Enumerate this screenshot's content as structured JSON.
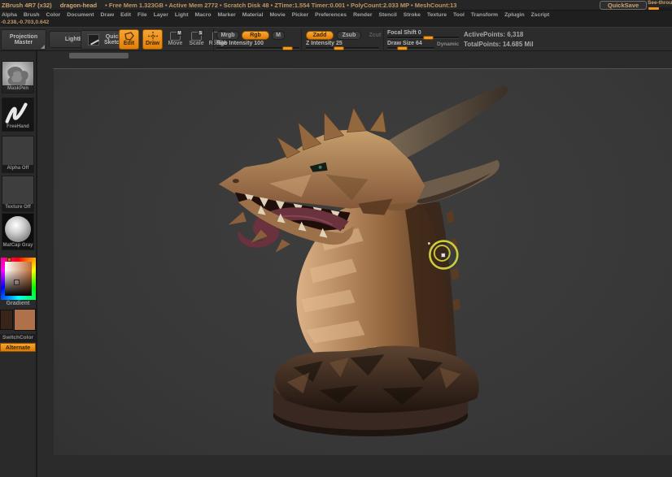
{
  "titlebar": {
    "app": "ZBrush 4R7 (x32)",
    "document_name": "dragon-head",
    "stats": "• Free Mem 1.323GB • Active Mem 2772 • Scratch Disk 48 • ZTime:1.554 Timer:0.001 • PolyCount:2.033 MP • MeshCount:13",
    "quicksave": "QuickSave",
    "seethrough": "See-through"
  },
  "menubar": {
    "items": [
      "Alpha",
      "Brush",
      "Color",
      "Document",
      "Draw",
      "Edit",
      "File",
      "Layer",
      "Light",
      "Macro",
      "Marker",
      "Material",
      "Movie",
      "Picker",
      "Preferences",
      "Render",
      "Stencil",
      "Stroke",
      "Texture",
      "Tool",
      "Transform",
      "Zplugin",
      "Zscript"
    ]
  },
  "coords": "-0.238,-0.703,0.642",
  "toolbar": {
    "buttons": {
      "projection_master": "Projection Master",
      "lightbox": "LightBox",
      "quick_sketch": "Quick Sketch",
      "edit": "Edit",
      "draw": "Draw",
      "move": "Move",
      "scale": "Scale",
      "rotate": "Rotate",
      "mrgb": "Mrgb",
      "rgb": "Rgb",
      "m": "M",
      "zadd": "Zadd",
      "zsub": "Zsub",
      "zcut": "Zcut",
      "dynamic": "Dynamic"
    },
    "badges": {
      "move": "M",
      "scale": "S",
      "rotate": "R"
    },
    "sliders": {
      "rgb_intensity": {
        "label": "Rgb Intensity 100",
        "pct": 86
      },
      "z_intensity": {
        "label": "Z Intensity 25",
        "pct": 46
      },
      "focal_shift": {
        "label": "Focal Shift 0",
        "pct": 58
      },
      "draw_size": {
        "label": "Draw Size 64",
        "pct": 32
      }
    },
    "stats": {
      "active_points": "ActivePoints: 6,318",
      "total_points": "TotalPoints: 14.685 Mil"
    }
  },
  "sidebar": {
    "brush_label": "MaskPen",
    "stroke_label": "FreeHand",
    "alpha_label": "Alpha Off",
    "texture_label": "Texture Off",
    "material_label": "MatCap Gray",
    "gradient_label": "Gradient",
    "switchcolor_label": "SwitchColor",
    "alternate_label": "Alternate"
  },
  "colors": {
    "accent_orange": "#ee9220",
    "canvas_gray": "#3a3a3a",
    "main_color": "#b0714a",
    "secondary_color": "#39241a",
    "cursor_yellow": "#d2d63e"
  }
}
